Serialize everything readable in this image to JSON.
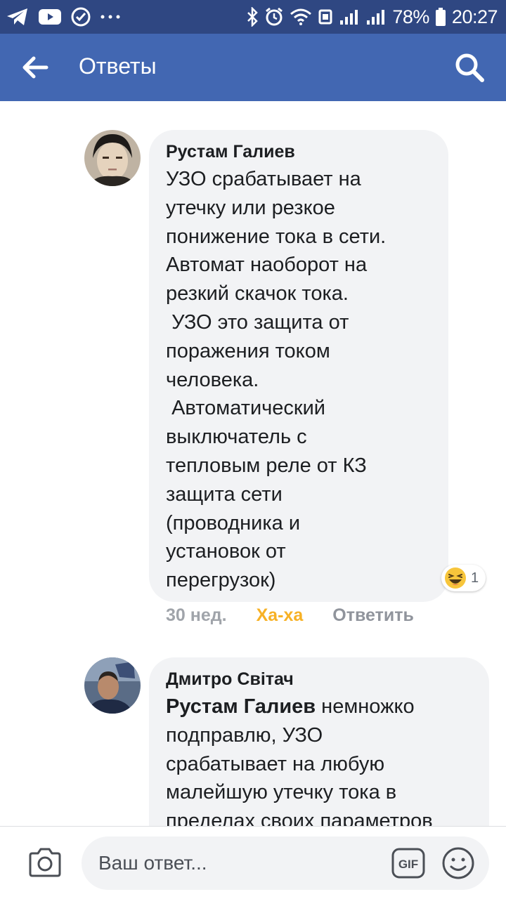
{
  "status_bar": {
    "left_icons": [
      "telegram-icon",
      "youtube-icon",
      "check-circle-icon",
      "more-dots-icon"
    ],
    "right_icons": [
      "bluetooth-icon",
      "alarm-icon",
      "wifi-icon",
      "signal-icon",
      "battery-icon"
    ],
    "battery": "78%",
    "time": "20:27"
  },
  "appbar": {
    "title": "Ответы",
    "back_icon": "arrow-left-icon",
    "search_icon": "search-icon",
    "background": "#4267b2"
  },
  "comments": [
    {
      "author": "Рустам Галиев",
      "text": "УЗО срабатывает на\nутечку или резкое\nпонижение тока в сети.\nАвтомат наоборот на\nрезкий скачок тока.\n УЗО это защита от\nпоражения током\nчеловека.\n Автоматический\nвыключатель с\nтепловым реле от КЗ\nзащита сети\n(проводника и\nустановок от\nперегрузок)",
      "time": "30 нед.",
      "reaction_label": "Ха-ха",
      "reply_label": "Ответить",
      "reaction_icon": "haha-emoji-icon",
      "reaction_count": "1"
    },
    {
      "author": "Дмитро Світач",
      "mention": "Рустам Галиев",
      "text": " немножко\nподправлю, УЗО\nсрабатывает на любую\nмалейшую утечку тока в\nпределах своих параметров"
    }
  ],
  "composer": {
    "placeholder": "Ваш ответ...",
    "camera_icon": "camera-icon",
    "gif_label": "GIF",
    "emoji_icon": "smiley-icon"
  },
  "colors": {
    "status_bar": "#2f4782",
    "bubble": "#f2f3f5",
    "haha": "#f7b125",
    "meta": "#90949c"
  }
}
